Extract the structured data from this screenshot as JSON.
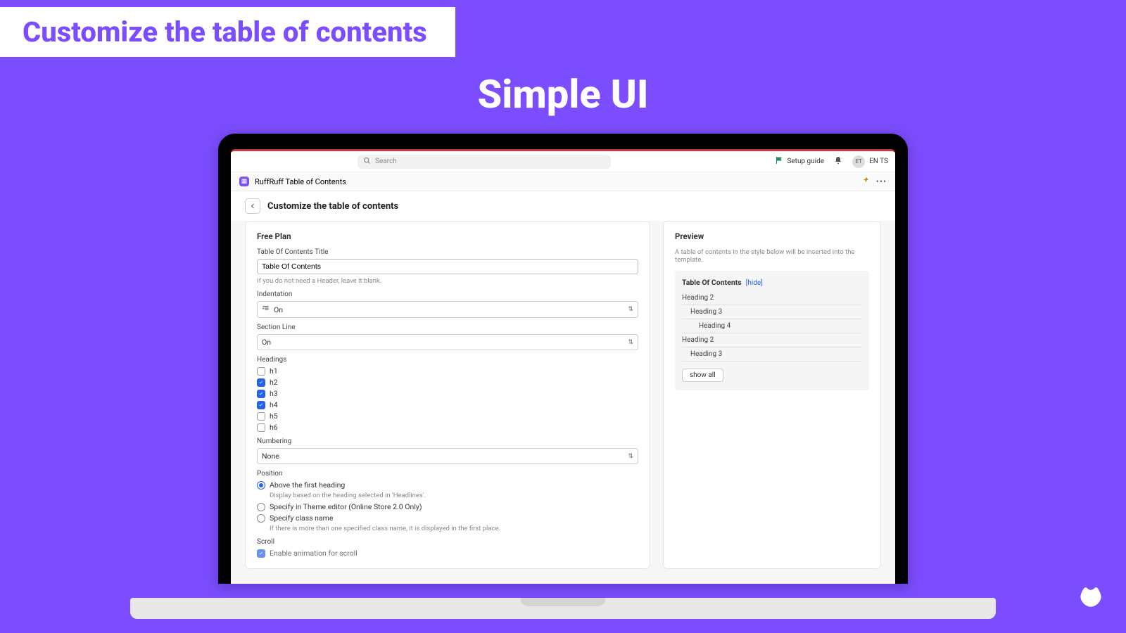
{
  "banner": "Customize the table of contents",
  "hero": "Simple UI",
  "topbar": {
    "search_placeholder": "Search",
    "setup_guide": "Setup guide",
    "avatar_initials": "ET",
    "user_label": "EN TS"
  },
  "appbar": {
    "app_name": "RuffRuff Table of Contents"
  },
  "page": {
    "title": "Customize the table of contents"
  },
  "form": {
    "plan_title": "Free Plan",
    "toc_title_label": "Table Of Contents Title",
    "toc_title_value": "Table Of Contents",
    "toc_title_help": "If you do not need a Header, leave it blank.",
    "indentation_label": "Indentation",
    "indentation_value": "On",
    "section_line_label": "Section Line",
    "section_line_value": "On",
    "headings_label": "Headings",
    "headings": [
      {
        "label": "h1",
        "checked": false
      },
      {
        "label": "h2",
        "checked": true
      },
      {
        "label": "h3",
        "checked": true
      },
      {
        "label": "h4",
        "checked": true
      },
      {
        "label": "h5",
        "checked": false
      },
      {
        "label": "h6",
        "checked": false
      }
    ],
    "numbering_label": "Numbering",
    "numbering_value": "None",
    "position_label": "Position",
    "position_options": [
      {
        "label": "Above the first heading",
        "selected": true,
        "help": "Display based on the heading selected in 'Headlines'."
      },
      {
        "label": "Specify in Theme editor (Online Store 2.0 Only)",
        "selected": false,
        "help": ""
      },
      {
        "label": "Specify class name",
        "selected": false,
        "help": "If there is more than one specified class name, it is displayed in the first place."
      }
    ],
    "scroll_label": "Scroll",
    "scroll_option": "Enable animation for scroll"
  },
  "preview": {
    "title": "Preview",
    "desc": "A table of contents in the style below will be inserted into the template.",
    "toc_title": "Table Of Contents",
    "toc_hide": "[hide]",
    "items": [
      {
        "label": "Heading 2",
        "indent": 1
      },
      {
        "label": "Heading 3",
        "indent": 2
      },
      {
        "label": "Heading 4",
        "indent": 3
      },
      {
        "label": "Heading 2",
        "indent": 1
      },
      {
        "label": "Heading 3",
        "indent": 2
      }
    ],
    "show_all": "show all"
  }
}
